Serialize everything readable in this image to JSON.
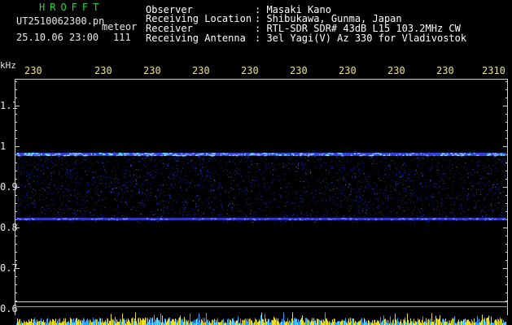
{
  "brand": "HROFFT",
  "file": {
    "name": "UT2510062300.pn",
    "detector": "meteor",
    "datetime": "25.10.06 23:00",
    "count": "111"
  },
  "info": [
    {
      "label": "Observer",
      "value": ": Masaki Kano"
    },
    {
      "label": "Receiving Location",
      "value": ": Shibukawa, Gunma, Japan"
    },
    {
      "label": "Receiver",
      "value": ": RTL-SDR SDR# 43dB L15 103.2MHz CW"
    },
    {
      "label": "Receiving Antenna",
      "value": ": 3el Yagi(V) Az 330 for Vladivostok"
    }
  ],
  "axis": {
    "unit": "kHz",
    "x_ticks": [
      "230",
      "230",
      "230",
      "230",
      "230",
      "230",
      "230",
      "230",
      "230",
      "2310"
    ],
    "y_ticks": [
      "1.1",
      "1",
      "0.9",
      "0.8",
      "0.7",
      "0.6"
    ]
  },
  "colors": {
    "brand": "#2fd14a",
    "tick": "#e8e090",
    "signal": "#3a4cff",
    "meteor": "#d8e6ff",
    "bars": "#e8e020"
  }
}
